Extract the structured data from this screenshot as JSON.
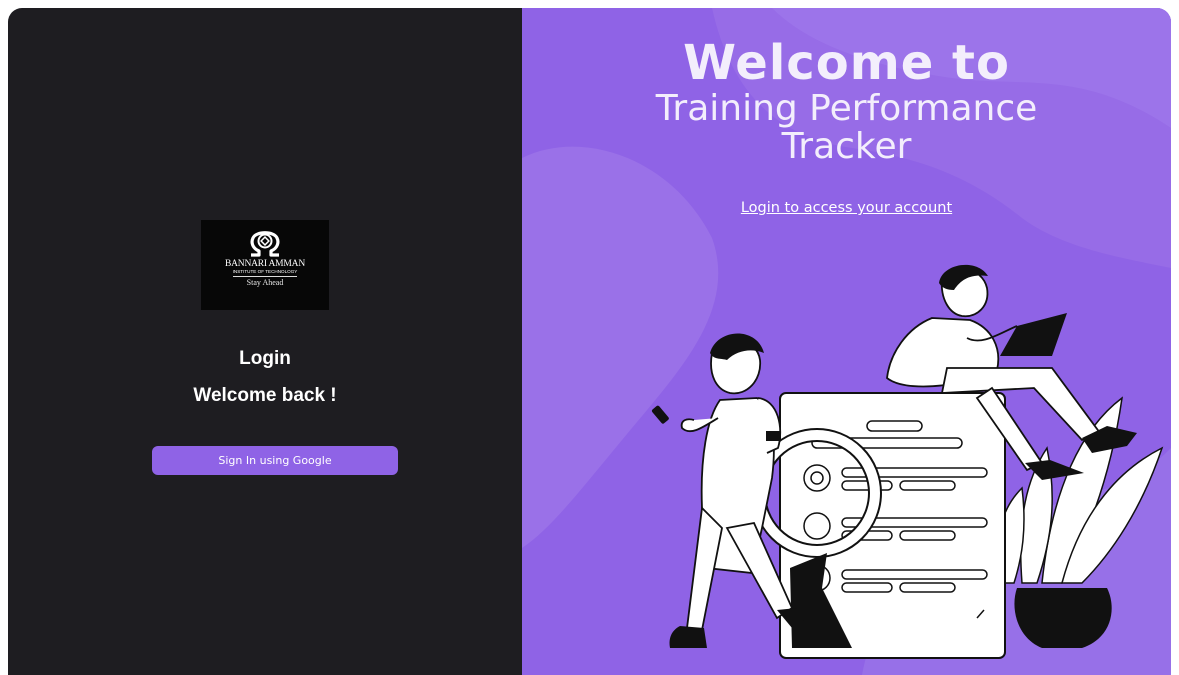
{
  "colors": {
    "left_panel_bg": "#1e1d21",
    "right_panel_bg": "#8f63e6",
    "button_bg": "#8f63e6",
    "text_light": "#ffffff"
  },
  "logo": {
    "line1": "BANNARI AMMAN",
    "line2": "INSTITUTE OF TECHNOLOGY",
    "line3": "Stay Ahead",
    "icon": "omega-emblem-icon"
  },
  "login": {
    "title": "Login",
    "subtitle": "Welcome back !",
    "google_button_label": "Sign In using Google"
  },
  "hero": {
    "title": "Welcome to",
    "subtitle_line1": "Training Performance",
    "subtitle_line2": "Tracker",
    "link_text": "Login to access your account"
  },
  "illustration": {
    "icon": "people-with-documents-illustration"
  }
}
